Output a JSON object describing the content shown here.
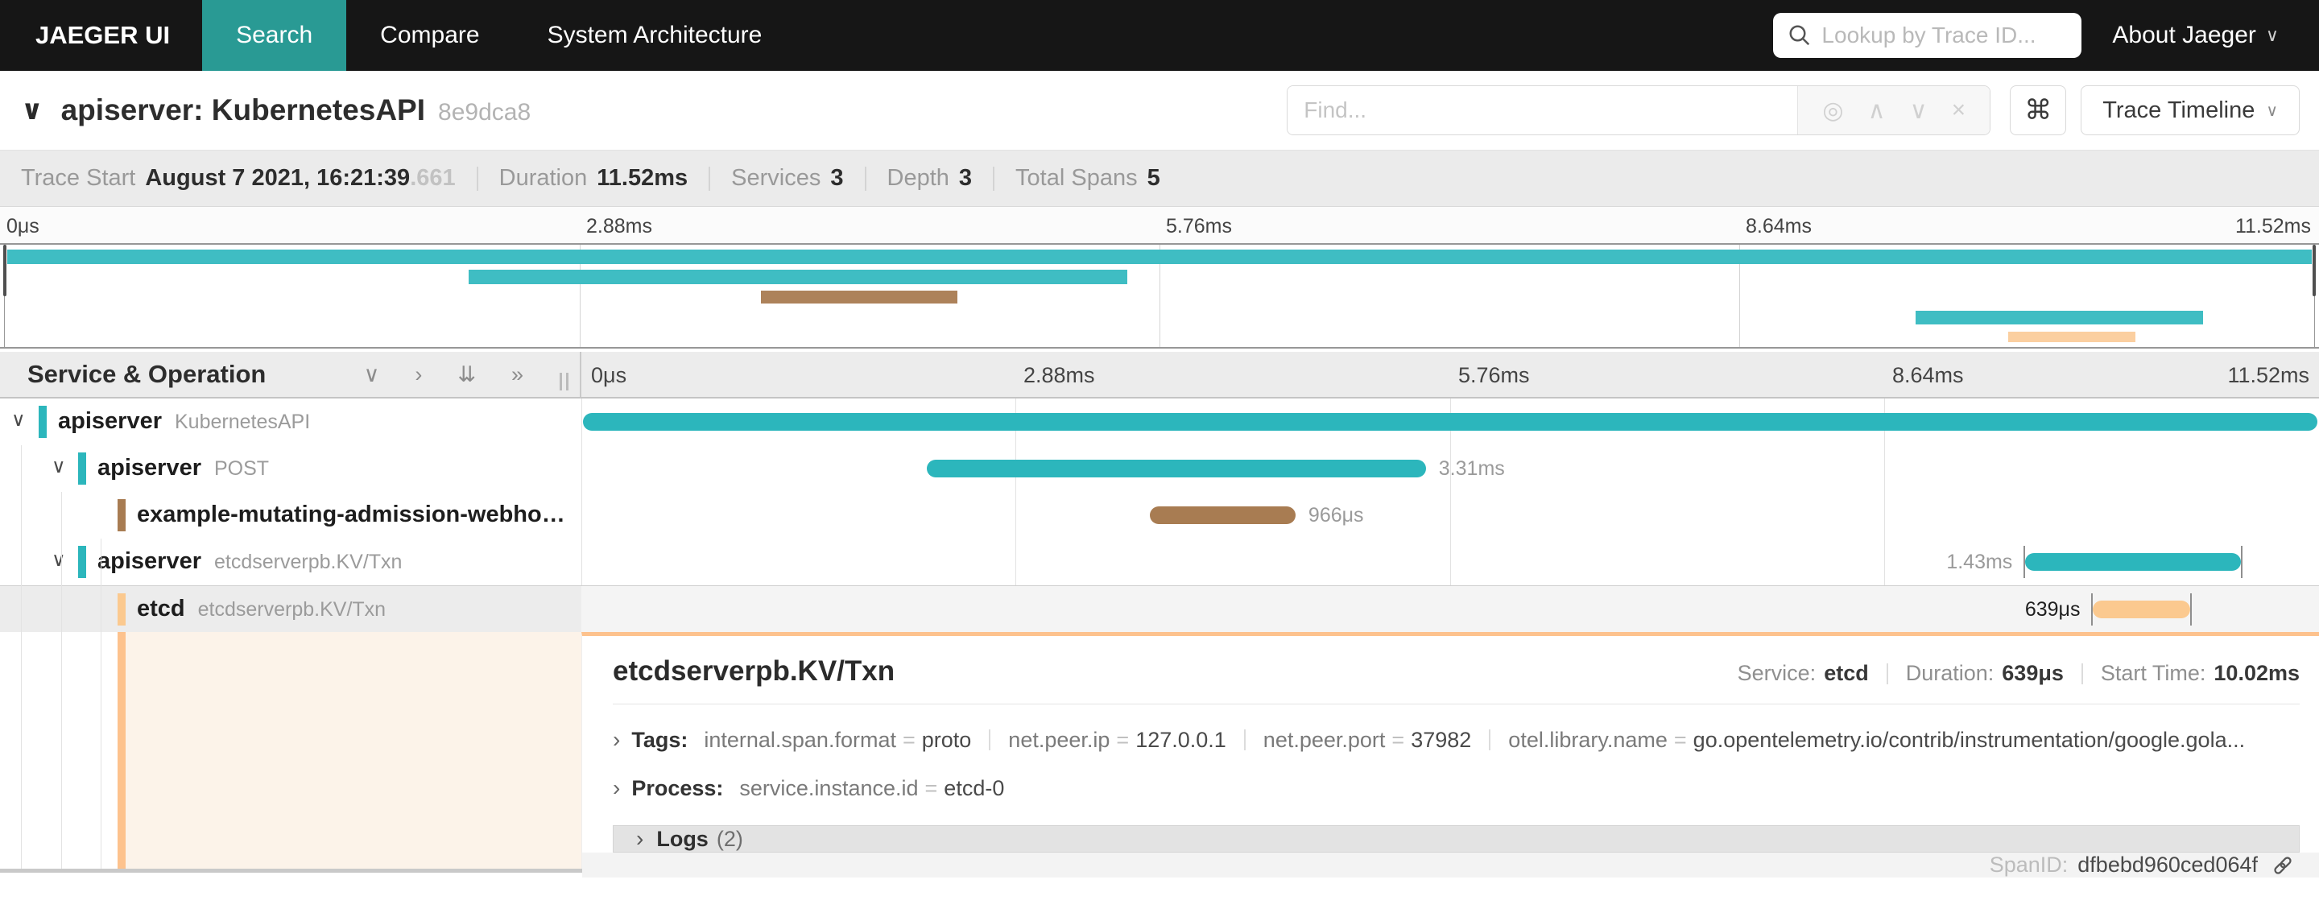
{
  "glyphs": {
    "chevron_down": "∨",
    "chevron_right": "›",
    "double_chevron_down": "⇊",
    "double_chevron_right": "»",
    "target": "◎",
    "up": "∧",
    "down": "∨",
    "close": "×",
    "command": "⌘"
  },
  "nav": {
    "brand": "JAEGER UI",
    "tabs": [
      {
        "label": "Search",
        "active": true
      },
      {
        "label": "Compare",
        "active": false
      },
      {
        "label": "System Architecture",
        "active": false
      }
    ],
    "lookup_placeholder": "Lookup by Trace ID...",
    "about": "About Jaeger"
  },
  "trace_header": {
    "title": "apiserver: KubernetesAPI",
    "trace_id": "8e9dca8",
    "find_placeholder": "Find...",
    "view_selector": "Trace Timeline"
  },
  "summary": {
    "items": [
      {
        "label": "Trace Start",
        "value": "August 7 2021, 16:21:39",
        "suffix": ".661"
      },
      {
        "label": "Duration",
        "value": "11.52ms",
        "suffix": ""
      },
      {
        "label": "Services",
        "value": "3",
        "suffix": ""
      },
      {
        "label": "Depth",
        "value": "3",
        "suffix": ""
      },
      {
        "label": "Total Spans",
        "value": "5",
        "suffix": ""
      }
    ]
  },
  "timeline": {
    "ticks": [
      "0μs",
      "2.88ms",
      "5.76ms",
      "8.64ms",
      "11.52ms"
    ],
    "header_left": "Service & Operation"
  },
  "minimap": {
    "bars": [
      {
        "left": 0.3,
        "width": 99.4,
        "color": "#3fbdc3"
      },
      {
        "left": 20.2,
        "width": 28.4,
        "color": "#3fbdc3"
      },
      {
        "left": 32.8,
        "width": 8.5,
        "color": "#ad825a"
      },
      {
        "left": 82.6,
        "width": 12.4,
        "color": "#3fbdc3"
      },
      {
        "left": 86.6,
        "width": 5.5,
        "color": "#fbcfa0"
      }
    ]
  },
  "spans": [
    {
      "service": "apiserver",
      "operation": "KubernetesAPI",
      "bar": {
        "left": 0.1,
        "width": 99.8,
        "color": "#2cb6bc"
      },
      "label": ""
    },
    {
      "service": "apiserver",
      "operation": "POST",
      "bar": {
        "left": 19.9,
        "width": 28.7,
        "color": "#2cb6bc"
      },
      "label": "3.31ms"
    },
    {
      "service": "example-mutating-admission-webhook...",
      "operation": "",
      "bar": {
        "left": 32.7,
        "width": 8.4,
        "color": "#a87c52"
      },
      "label": "966μs"
    },
    {
      "service": "apiserver",
      "operation": "etcdserverpb.KV/Txn",
      "bar": {
        "left": 83.1,
        "width": 12.4,
        "color": "#2cb6bc"
      },
      "label": "1.43ms"
    },
    {
      "service": "etcd",
      "operation": "etcdserverpb.KV/Txn",
      "bar": {
        "left": 87.0,
        "width": 5.6,
        "color": "#fbc98f"
      },
      "label": "639μs"
    }
  ],
  "detail": {
    "title": "etcdserverpb.KV/Txn",
    "meta": [
      {
        "label": "Service:",
        "value": "etcd"
      },
      {
        "label": "Duration:",
        "value": "639μs"
      },
      {
        "label": "Start Time:",
        "value": "10.02ms"
      }
    ],
    "tags_title": "Tags:",
    "tags": [
      {
        "key": "internal.span.format",
        "value": "proto"
      },
      {
        "key": "net.peer.ip",
        "value": "127.0.0.1"
      },
      {
        "key": "net.peer.port",
        "value": "37982"
      },
      {
        "key": "otel.library.name",
        "value": "go.opentelemetry.io/contrib/instrumentation/google.gola..."
      }
    ],
    "process_title": "Process:",
    "process": {
      "key": "service.instance.id",
      "value": "etcd-0"
    },
    "logs_label": "Logs",
    "logs_count": "(2)",
    "span_id_label": "SpanID:",
    "span_id": "dfbebd960ced064f"
  }
}
